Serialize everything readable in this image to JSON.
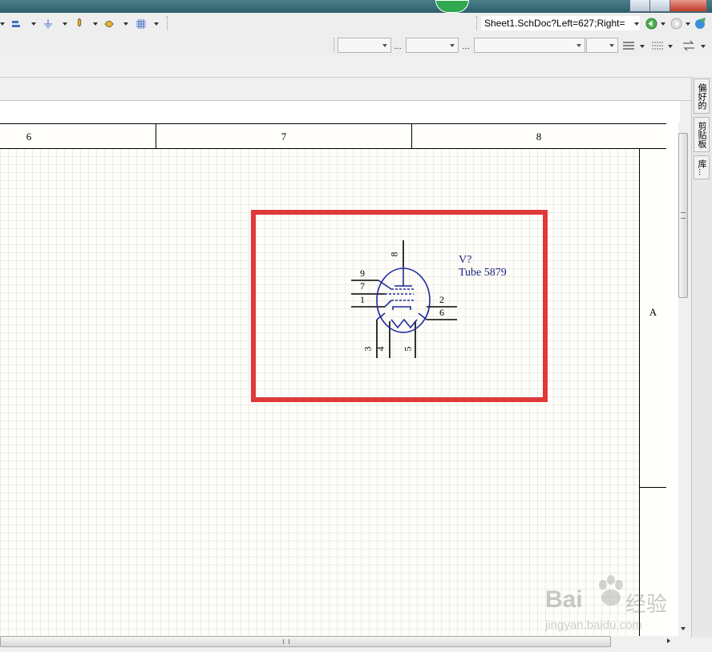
{
  "toolbar": {
    "document_path": "Sheet1.SchDoc?Left=627;Right="
  },
  "sidebar": {
    "tabs": [
      {
        "label": "偏好的"
      },
      {
        "label": "剪贴板"
      },
      {
        "label": "库..."
      }
    ]
  },
  "sheet": {
    "zones_top": [
      "6",
      "7",
      "8"
    ],
    "zones_right": [
      "A"
    ]
  },
  "component": {
    "designator": "V?",
    "comment": "Tube 5879",
    "pins": {
      "p8": "8",
      "p9": "9",
      "p7": "7",
      "p1": "1",
      "p2": "2",
      "p6": "6",
      "p3": "3",
      "p4": "4",
      "p5": "5"
    }
  },
  "watermark": {
    "brand": "Bai",
    "brand_cn": "经验",
    "url": "jingyan.baidu.com"
  },
  "colors": {
    "highlight": "#e0393a",
    "component_line": "#1f2a9c",
    "component_text": "#1a237e",
    "sheet_bg": "#fffefa"
  }
}
